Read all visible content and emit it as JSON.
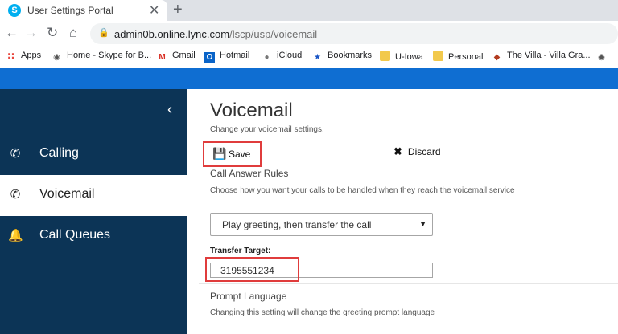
{
  "browser": {
    "tab_title": "User Settings Portal",
    "tab_favicon": "S",
    "close_glyph": "✕",
    "newtab_glyph": "+",
    "url_host": "admin0b.online.lync.com",
    "url_path": "/lscp/usp/voicemail"
  },
  "bookmarks": [
    {
      "label": "Apps",
      "icon": "apps-grid-icon"
    },
    {
      "label": "Home - Skype for B...",
      "icon": "globe-icon"
    },
    {
      "label": "Gmail",
      "icon": "gmail-icon"
    },
    {
      "label": "Hotmail",
      "icon": "outlook-icon"
    },
    {
      "label": "iCloud",
      "icon": "apple-icon"
    },
    {
      "label": "Bookmarks",
      "icon": "star-icon"
    },
    {
      "label": "U-Iowa",
      "icon": "folder-icon"
    },
    {
      "label": "Personal",
      "icon": "folder-icon"
    },
    {
      "label": "The Villa - Villa Gra...",
      "icon": "villa-icon"
    }
  ],
  "sidebar": {
    "collapse_glyph": "‹",
    "items": [
      {
        "label": "Calling",
        "icon": "phone-icon",
        "active": false
      },
      {
        "label": "Voicemail",
        "icon": "voicemail-phone-icon",
        "active": true
      },
      {
        "label": "Call Queues",
        "icon": "bell-icon",
        "active": false
      }
    ]
  },
  "main": {
    "title": "Voicemail",
    "subtitle": "Change your voicemail settings.",
    "save_label": "Save",
    "discard_label": "Discard",
    "call_answer": {
      "title": "Call Answer Rules",
      "desc": "Choose how you want your calls to be handled when they reach the voicemail service",
      "selected": "Play greeting, then transfer the call"
    },
    "transfer": {
      "label": "Transfer Target:",
      "value": "3195551234"
    },
    "prompt": {
      "title": "Prompt Language",
      "desc": "Changing this setting will change the greeting prompt language"
    }
  },
  "colors": {
    "banner": "#0f6ed2",
    "sidebar": "#0c3456",
    "highlight": "#e03c3c"
  }
}
